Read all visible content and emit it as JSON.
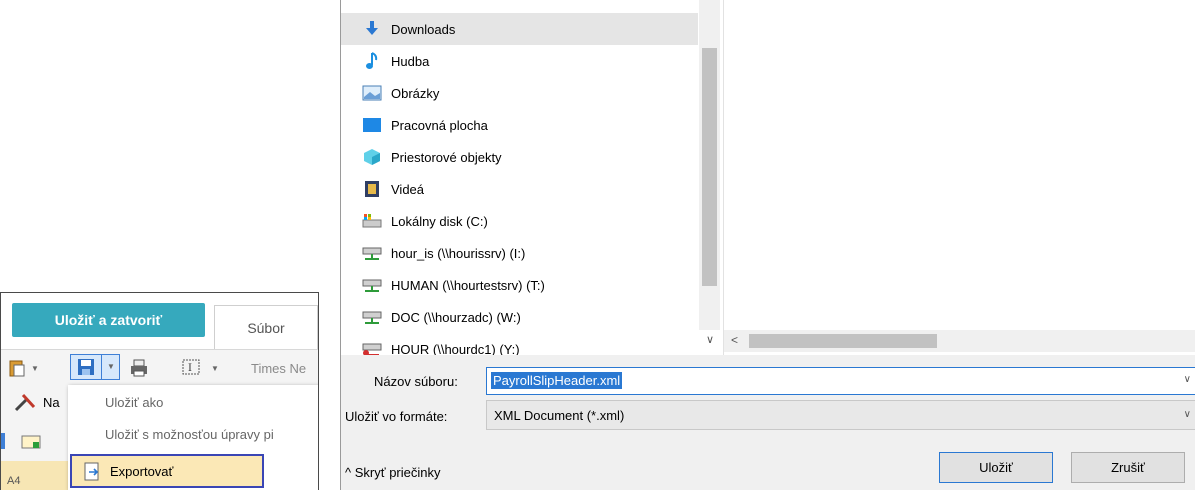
{
  "editor": {
    "save_close_label": "Uložiť a zatvoriť",
    "tab_file_label": "Súbor",
    "font_name": "Times Ne",
    "row2_label": "Na",
    "row4_label": "A4",
    "menu": {
      "save_as": "Uložiť ako",
      "save_with_edit": "Uložiť s možnosťou úpravy pi",
      "export": "Exportovať"
    }
  },
  "dialog": {
    "nav_items": [
      {
        "label": "Downloads",
        "icon": "download-arrow-icon"
      },
      {
        "label": "Hudba",
        "icon": "music-note-icon"
      },
      {
        "label": "Obrázky",
        "icon": "pictures-icon"
      },
      {
        "label": "Pracovná plocha",
        "icon": "desktop-icon"
      },
      {
        "label": "Priestorové objekty",
        "icon": "3d-objects-icon"
      },
      {
        "label": "Videá",
        "icon": "videos-icon"
      },
      {
        "label": "Lokálny disk (C:)",
        "icon": "local-disk-icon"
      },
      {
        "label": "hour_is (\\\\hourissrv) (I:)",
        "icon": "network-drive-icon"
      },
      {
        "label": "HUMAN (\\\\hourtestsrv) (T:)",
        "icon": "network-drive-icon"
      },
      {
        "label": "DOC (\\\\hourzadc) (W:)",
        "icon": "network-drive-icon"
      },
      {
        "label": "HOUR (\\\\hourdc1) (Y:)",
        "icon": "network-drive-disconnected-icon"
      }
    ],
    "filename_label": "Názov súboru:",
    "filename_value": "PayrollSlipHeader.xml",
    "filetype_label": "Uložiť vo formáte:",
    "filetype_value": "XML Document (*.xml)",
    "hide_folders_label": "Skryť priečinky",
    "save_label": "Uložiť",
    "cancel_label": "Zrušiť"
  },
  "colors": {
    "accent": "#36a9bd",
    "selection": "#2a78d2",
    "highlight_box": "#3a46b5"
  }
}
